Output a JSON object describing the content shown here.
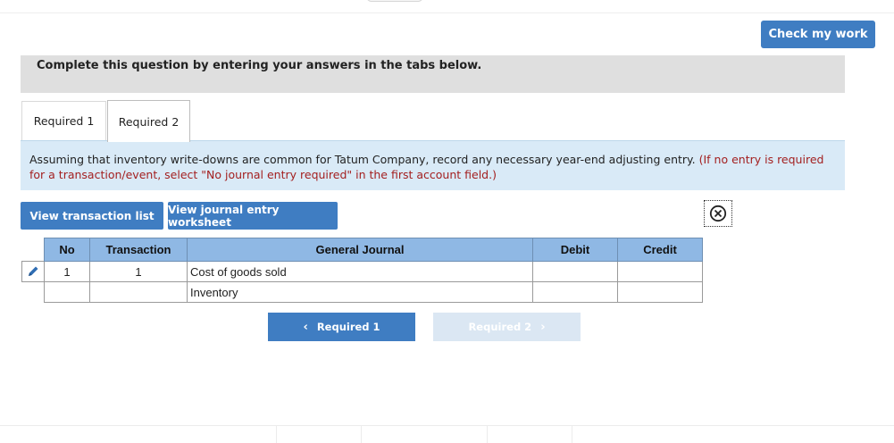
{
  "header": {
    "check_button_label": "Check my work"
  },
  "instructions": "Complete this question by entering your answers in the tabs below.",
  "tabs": [
    {
      "label": "Required 1",
      "active": false
    },
    {
      "label": "Required 2",
      "active": true
    }
  ],
  "info": {
    "main": "Assuming that inventory write-downs are common for Tatum Company, record any necessary year-end adjusting entry.",
    "note": "(If no entry is required for a transaction/event, select \"No journal entry required\" in the first account field.)"
  },
  "buttons": {
    "view_transaction_list": "View transaction list",
    "view_journal_worksheet": "View journal entry worksheet"
  },
  "journal": {
    "headers": [
      "No",
      "Transaction",
      "General Journal",
      "Debit",
      "Credit"
    ],
    "rows": [
      {
        "no": "1",
        "transaction": "1",
        "account": "Cost of goods sold",
        "debit": "",
        "credit": ""
      },
      {
        "no": "",
        "transaction": "",
        "account": "Inventory",
        "debit": "",
        "credit": ""
      }
    ]
  },
  "nav": {
    "prev_label": "Required 1",
    "next_label": "Required 2"
  },
  "icons": {
    "edit": "pencil-icon",
    "close": "close-circle-icon",
    "prev": "chevron-left-icon",
    "next": "chevron-right-icon"
  },
  "colors": {
    "primary": "#3f7dc2",
    "primary_disabled": "#dbe7f3",
    "table_header": "#8fb8e4",
    "info_bg": "#d9eaf7",
    "note_red": "#a31f1f",
    "instruction_bg": "#dfdfdf"
  }
}
